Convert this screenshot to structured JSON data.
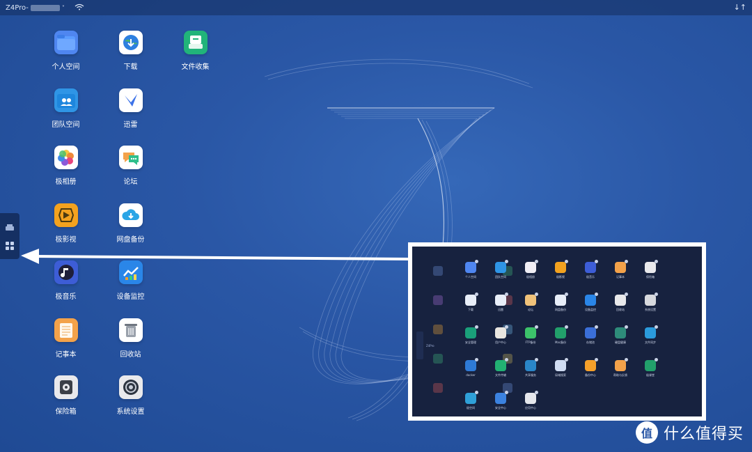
{
  "topbar": {
    "device_name": "Z4Pro-",
    "device_dropdown": "˅",
    "right_icon": "↓↑"
  },
  "desktop_apps": [
    {
      "label": "个人空间",
      "icon": "folder-icon",
      "color": "#4f86f0"
    },
    {
      "label": "下载",
      "icon": "globe-download-icon",
      "color": "#ffffff"
    },
    {
      "label": "文件收集",
      "icon": "file-collect-icon",
      "color": "#21b47a"
    },
    {
      "label": "团队空间",
      "icon": "team-folder-icon",
      "color": "#2f95e6"
    },
    {
      "label": "迅雷",
      "icon": "thunder-bird-icon",
      "color": "#ffffff"
    },
    null,
    {
      "label": "极相册",
      "icon": "photos-icon",
      "color": "#ffffff"
    },
    {
      "label": "论坛",
      "icon": "forum-chat-icon",
      "color": "#ffffff"
    },
    null,
    {
      "label": "极影视",
      "icon": "video-icon",
      "color": "#f3a21f"
    },
    {
      "label": "网盘备份",
      "icon": "cloud-backup-icon",
      "color": "#ffffff"
    },
    null,
    {
      "label": "极音乐",
      "icon": "music-icon",
      "color": "#3d5dd6"
    },
    {
      "label": "设备监控",
      "icon": "monitor-chart-icon",
      "color": "#2a86e8"
    },
    null,
    {
      "label": "记事本",
      "icon": "notepad-icon",
      "color": "#f3a24a"
    },
    {
      "label": "回收站",
      "icon": "trash-icon",
      "color": "#ffffff"
    },
    null,
    {
      "label": "保险箱",
      "icon": "safe-icon",
      "color": "#e9e9ec"
    },
    {
      "label": "系统设置",
      "icon": "settings-icon",
      "color": "#e9e9ec"
    },
    null
  ],
  "inset_apps": [
    {
      "label": "个人空间",
      "color": "#4f86f0"
    },
    {
      "label": "团队空间",
      "color": "#2f95e6"
    },
    {
      "label": "极相册",
      "color": "#f0eef5"
    },
    {
      "label": "极影视",
      "color": "#f3a21f"
    },
    {
      "label": "极音乐",
      "color": "#3d5dd6"
    },
    {
      "label": "记事本",
      "color": "#f3a24a"
    },
    {
      "label": "保险箱",
      "color": "#e9e9ec"
    },
    {
      "label": "下载",
      "color": "#e8eef8"
    },
    {
      "label": "迅雷",
      "color": "#e8eef8"
    },
    {
      "label": "论坛",
      "color": "#f0c27a"
    },
    {
      "label": "网盘备份",
      "color": "#e8eef8"
    },
    {
      "label": "设备监控",
      "color": "#2a86e8"
    },
    {
      "label": "回收站",
      "color": "#e8e8ea"
    },
    {
      "label": "系统设置",
      "color": "#d7d9de"
    },
    {
      "label": "安全管理",
      "color": "#1aa07a"
    },
    {
      "label": "用户中心",
      "color": "#e9e6e0"
    },
    {
      "label": "FTP备份",
      "color": "#3cc26a"
    },
    {
      "label": "Mac备份",
      "color": "#22a06b"
    },
    {
      "label": "存储池",
      "color": "#3b6fd8"
    },
    {
      "label": "硬盘健康",
      "color": "#2e8c7a"
    },
    {
      "label": "文件同步",
      "color": "#2b9bdc"
    },
    {
      "label": "docker",
      "color": "#2e7ad6"
    },
    {
      "label": "文件传输",
      "color": "#22b173"
    },
    {
      "label": "共享服务",
      "color": "#2a86c8"
    },
    {
      "label": "局域搜索",
      "color": "#d0dcf2"
    },
    {
      "label": "备份中心",
      "color": "#f5a02a"
    },
    {
      "label": "帮助与反馈",
      "color": "#f3a24a"
    },
    {
      "label": "极课堂",
      "color": "#22a06b"
    },
    {
      "label": "极空间",
      "color": "#2fa0d8"
    },
    {
      "label": "安全中心",
      "color": "#3b82e0"
    },
    {
      "label": "应用中心",
      "color": "#e5e7ec"
    }
  ],
  "inset": {
    "tag": "Z4Pro"
  },
  "sidebar": {
    "items": [
      {
        "icon": "drive-icon"
      },
      {
        "icon": "apps-grid-icon"
      }
    ]
  },
  "watermark": {
    "text": "什么值得买",
    "logo": "值"
  }
}
